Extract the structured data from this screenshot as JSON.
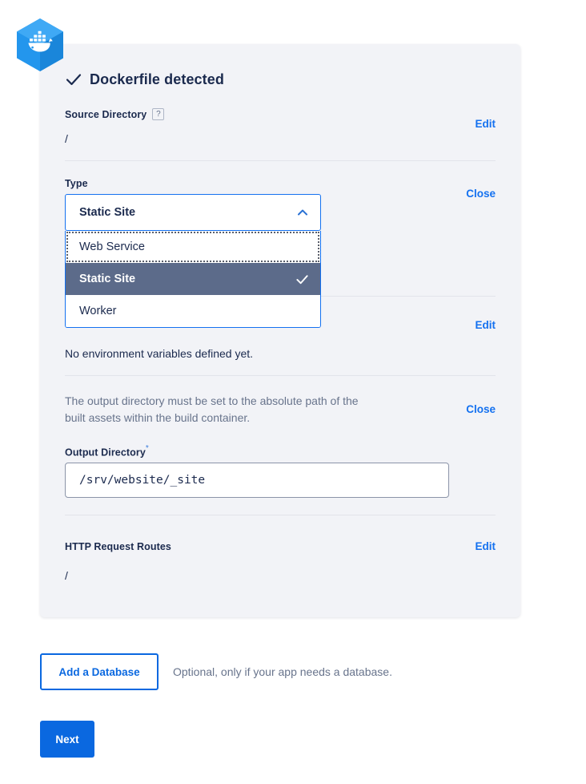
{
  "brand": {
    "logo_icon": "docker-logo-icon",
    "logo_color": "#2396ed",
    "logo_color_dark": "#1a86da"
  },
  "colors": {
    "accent_blue": "#0a68e0",
    "link_blue": "#1471f0",
    "card_bg": "#f2f3f7",
    "selected_row": "#5c6b8a",
    "text_dark": "#1b2a4e",
    "text_muted": "#68748c"
  },
  "card": {
    "header": {
      "check_icon": "check-icon",
      "title": "Dockerfile detected"
    },
    "source_directory": {
      "label": "Source Directory",
      "help_icon": "question-mark-icon",
      "help_glyph": "?",
      "value": "/",
      "action_label": "Edit"
    },
    "type": {
      "label": "Type",
      "selected": "Static Site",
      "action_label": "Close",
      "chevron_icon": "chevron-up-icon",
      "check_icon": "check-icon",
      "options": [
        {
          "label": "Web Service",
          "selected": false,
          "focused": true
        },
        {
          "label": "Static Site",
          "selected": true,
          "focused": false
        },
        {
          "label": "Worker",
          "selected": false,
          "focused": false
        }
      ]
    },
    "environment_variables": {
      "action_label": "Edit",
      "empty_text": "No environment variables defined yet."
    },
    "output_directory": {
      "help_text": "The output directory must be set to the absolute path of the built assets within the build container.",
      "action_label": "Close",
      "label": "Output Directory",
      "required_marker": "*",
      "value": "/srv/website/_site"
    },
    "http_request_routes": {
      "label": "HTTP Request Routes",
      "value": "/",
      "action_label": "Edit"
    }
  },
  "footer": {
    "add_database_label": "Add a Database",
    "add_database_note": "Optional, only if your app needs a database.",
    "next_label": "Next"
  }
}
